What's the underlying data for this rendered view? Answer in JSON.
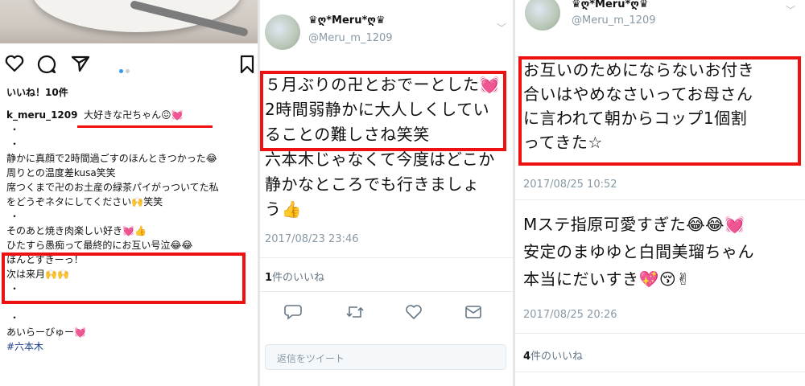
{
  "instagram": {
    "likes_label": "いいね！10件",
    "username": "k_meru_1209",
    "caption_lines": [
      "大好きな卍ちゃん😖💓",
      "・",
      "・",
      "静かに真顔で2時間過ごすのほんときつかった😂",
      "周りとの温度差kusa笑笑",
      "席つくまで卍のお土産の緑茶パイがっついてた私",
      "をどうぞネタにしてください🙌笑笑",
      "・",
      "そのあと焼き肉楽しい好き💓👍",
      "ひたすら愚痴って最終的にお互い号泣😂😂",
      "ほんとすきーっ！",
      "次は来月🙌🙌",
      "・",
      "・",
      "・",
      "あいらーびゅー💓"
    ],
    "hashtag": "#六本木",
    "icons": [
      "heart-icon",
      "comment-icon",
      "share-icon",
      "bookmark-icon"
    ]
  },
  "tweet1": {
    "display_name": "♛ღ*Meru*ღ♛",
    "handle": "@Meru_m_1209",
    "lines": [
      "５月ぶりの卍とおでーとした💓",
      "2時間弱静かに大人しくしてい",
      "ることの難しさね笑笑",
      "六本木じゃなくて今度はどこか",
      "静かなところでも行きましょ",
      "う👍"
    ],
    "timestamp": "2017/08/23 23:46",
    "like_count": "1",
    "like_label": "件のいいね",
    "reply_placeholder": "返信をツイート",
    "icons": [
      "reply-icon",
      "retweet-icon",
      "like-icon",
      "message-icon"
    ]
  },
  "tweet2": {
    "display_name": "♛ღ*Meru*ღ♛",
    "handle": "@Meru_m_1209",
    "lines": [
      "お互いのためにならないお付き",
      "合いはやめなさいってお母さん",
      "に言われて朝からコップ1個割",
      "ってきた☆"
    ],
    "timestamp": "2017/08/25 10:52"
  },
  "tweet3": {
    "lines": [
      "Mステ指原可愛すぎた😂😂💓",
      "安定のまゆゆと白間美瑠ちゃん",
      "本当にだいすき💖😚✌"
    ],
    "timestamp": "2017/08/25 20:26",
    "like_count": "4",
    "like_label": "件のいいね"
  },
  "colors": {
    "highlight": "#ee1111",
    "twitter_gray": "#8899a6",
    "ig_blue": "#3897f0"
  }
}
